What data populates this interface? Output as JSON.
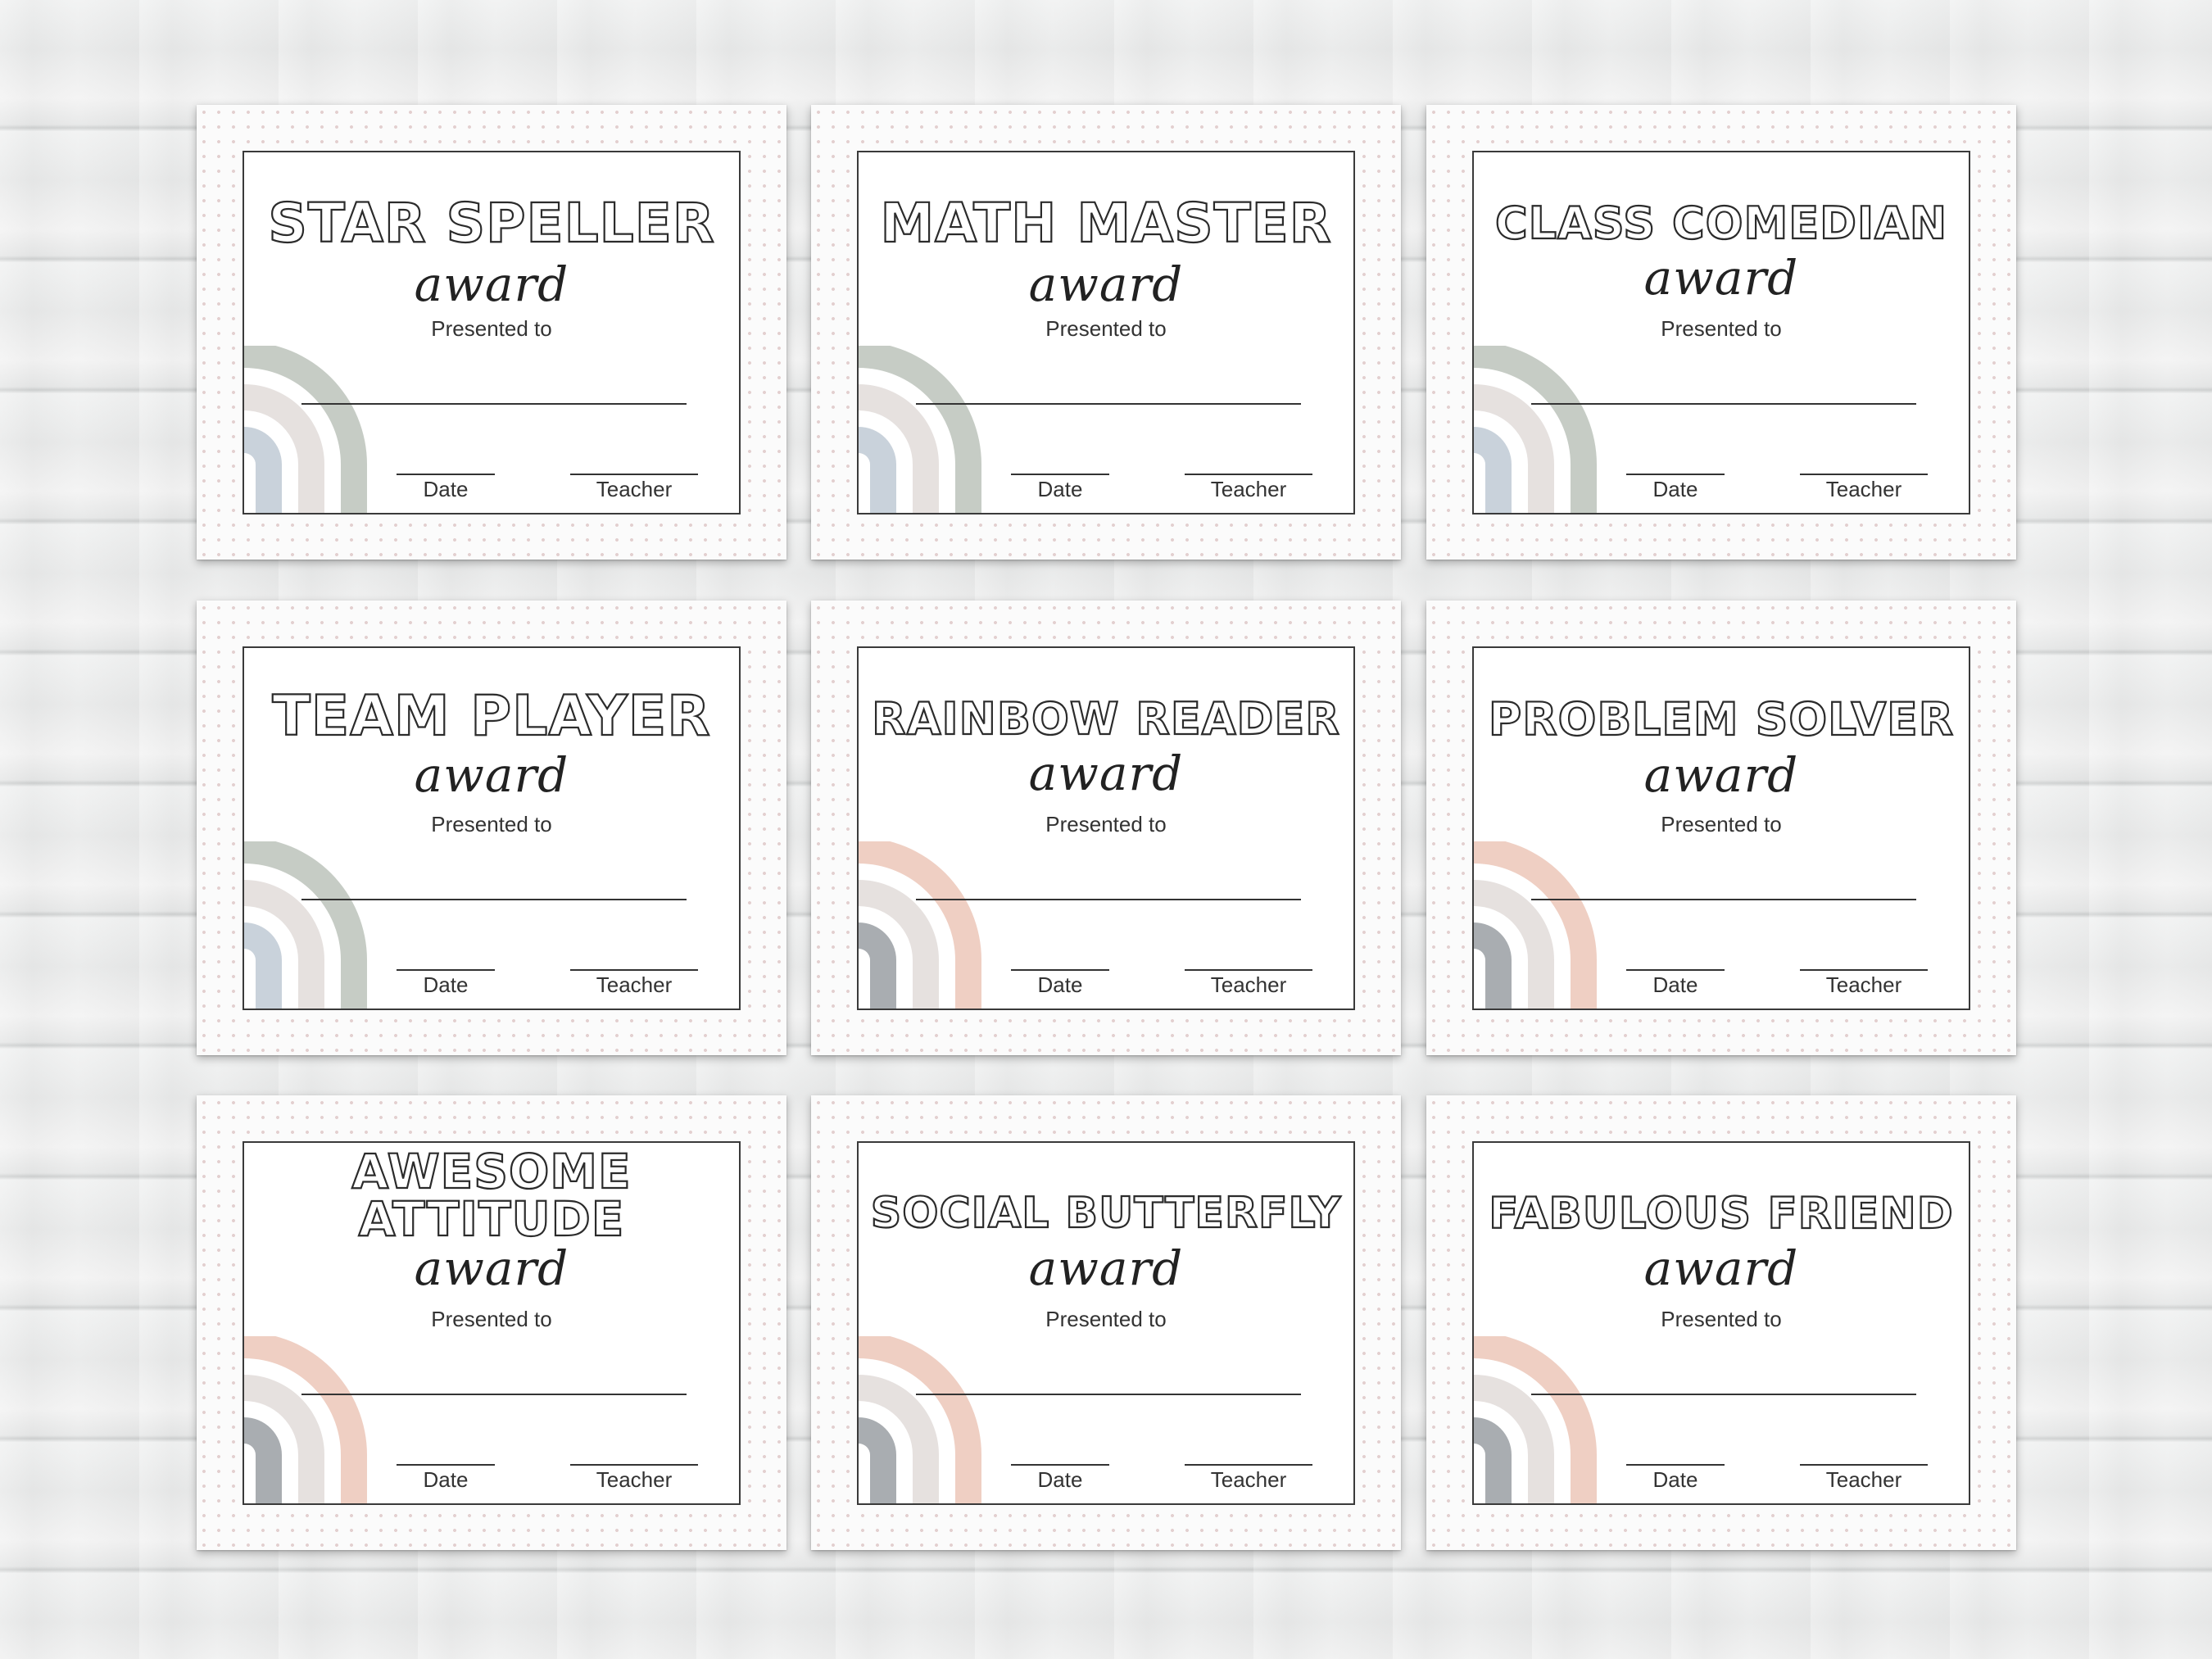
{
  "certificates": [
    {
      "title": "STAR SPELLER",
      "award": "award",
      "presented": "Presented to",
      "date": "Date",
      "teacher": "Teacher",
      "palette": [
        "#c6ccc5",
        "#e6e1df",
        "#c9d2db"
      ]
    },
    {
      "title": "MATH MASTER",
      "award": "award",
      "presented": "Presented to",
      "date": "Date",
      "teacher": "Teacher",
      "palette": [
        "#c6ccc5",
        "#e6e1df",
        "#c9d2db"
      ]
    },
    {
      "title": "CLASS COMEDIAN",
      "award": "award",
      "presented": "Presented to",
      "date": "Date",
      "teacher": "Teacher",
      "palette": [
        "#c6ccc5",
        "#e6e1df",
        "#c9d2db"
      ]
    },
    {
      "title": "TEAM PLAYER",
      "award": "award",
      "presented": "Presented to",
      "date": "Date",
      "teacher": "Teacher",
      "palette": [
        "#c6ccc5",
        "#e6e1df",
        "#c9d2db"
      ]
    },
    {
      "title": "RAINBOW READER",
      "award": "award",
      "presented": "Presented to",
      "date": "Date",
      "teacher": "Teacher",
      "palette": [
        "#efcfc3",
        "#e6e1df",
        "#a9adb1"
      ]
    },
    {
      "title": "PROBLEM SOLVER",
      "award": "award",
      "presented": "Presented to",
      "date": "Date",
      "teacher": "Teacher",
      "palette": [
        "#efcfc3",
        "#e6e1df",
        "#a9adb1"
      ]
    },
    {
      "title_lines": [
        "AWESOME",
        "ATTITUDE"
      ],
      "award": "award",
      "presented": "Presented to",
      "date": "Date",
      "teacher": "Teacher",
      "palette": [
        "#efcfc3",
        "#e6e1df",
        "#a9adb1"
      ]
    },
    {
      "title": "SOCIAL BUTTERFLY",
      "award": "award",
      "presented": "Presented to",
      "date": "Date",
      "teacher": "Teacher",
      "palette": [
        "#efcfc3",
        "#e6e1df",
        "#a9adb1"
      ]
    },
    {
      "title": "FABULOUS FRIEND",
      "award": "award",
      "presented": "Presented to",
      "date": "Date",
      "teacher": "Teacher",
      "palette": [
        "#efcfc3",
        "#e6e1df",
        "#a9adb1"
      ]
    }
  ]
}
